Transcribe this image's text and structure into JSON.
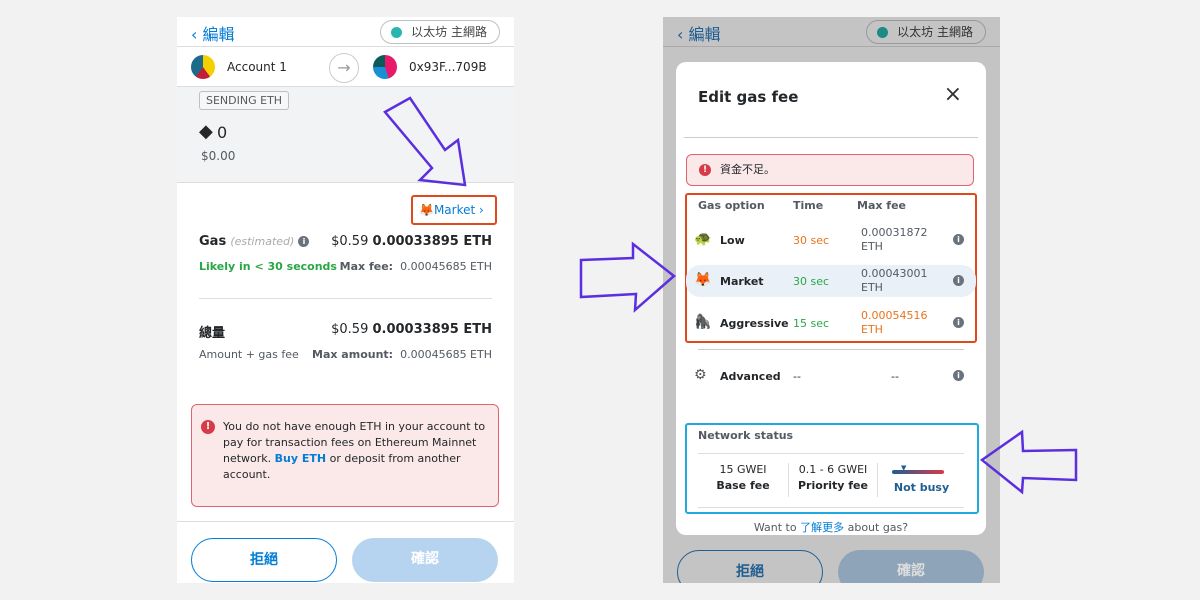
{
  "left": {
    "back_label": "編輯",
    "network": "以太坊 主網路",
    "from_account": "Account 1",
    "to_address": "0x93F...709B",
    "sending_badge": "SENDING ETH",
    "amount": "0",
    "amount_usd": "$0.00",
    "gas_option": "Market",
    "gas_option_icon": "🦊",
    "gas_label": "Gas",
    "gas_estimated": "(estimated)",
    "gas_usd": "$0.59",
    "gas_eth": "0.00033895 ETH",
    "likely": "Likely in < 30 seconds",
    "max_fee_label": "Max fee:",
    "max_fee": "0.00045685 ETH",
    "total_label": "總量",
    "total_usd": "$0.59",
    "total_eth": "0.00033895 ETH",
    "total_sub": "Amount + gas fee",
    "max_amount_label": "Max amount:",
    "max_amount": "0.00045685 ETH",
    "error_pre": "You do not have enough ETH in your account to pay for transaction fees on Ethereum Mainnet network. ",
    "error_link": "Buy ETH",
    "error_post": " or deposit from another account.",
    "reject": "拒絕",
    "confirm": "確認"
  },
  "right": {
    "back_label": "編輯",
    "network": "以太坊 主網路",
    "modal_title": "Edit gas fee",
    "error": "資金不足。",
    "columns": [
      "Gas option",
      "Time",
      "Max fee"
    ],
    "options": [
      {
        "icon": "🐢",
        "name": "Low",
        "time": "30 sec",
        "fee": "0.00031872 ETH",
        "time_color": "#e8741b",
        "fee_color": "#535a61"
      },
      {
        "icon": "🦊",
        "name": "Market",
        "time": "30 sec",
        "fee": "0.00043001 ETH",
        "time_color": "#28a745",
        "fee_color": "#535a61"
      },
      {
        "icon": "🦍",
        "name": "Aggressive",
        "time": "15 sec",
        "fee": "0.00054516 ETH",
        "time_color": "#28a745",
        "fee_color": "#e8741b"
      },
      {
        "icon": "⚙",
        "name": "Advanced",
        "time": "--",
        "fee": "--"
      }
    ],
    "network_status": "Network status",
    "base_fee_value": "15 GWEI",
    "base_fee_label": "Base fee",
    "priority_fee_value": "0.1 - 6 GWEI",
    "priority_fee_label": "Priority fee",
    "busy_label": "Not busy",
    "footer_pre": "Want to ",
    "footer_link": "了解更多",
    "footer_post": " about gas?",
    "reject": "拒絕",
    "confirm": "確認"
  },
  "colors": {
    "accent": "#037dd6",
    "highlight_orange": "#e0491c",
    "highlight_blue": "#1fa9e0",
    "annotation_arrow": "#5b2ee0"
  }
}
